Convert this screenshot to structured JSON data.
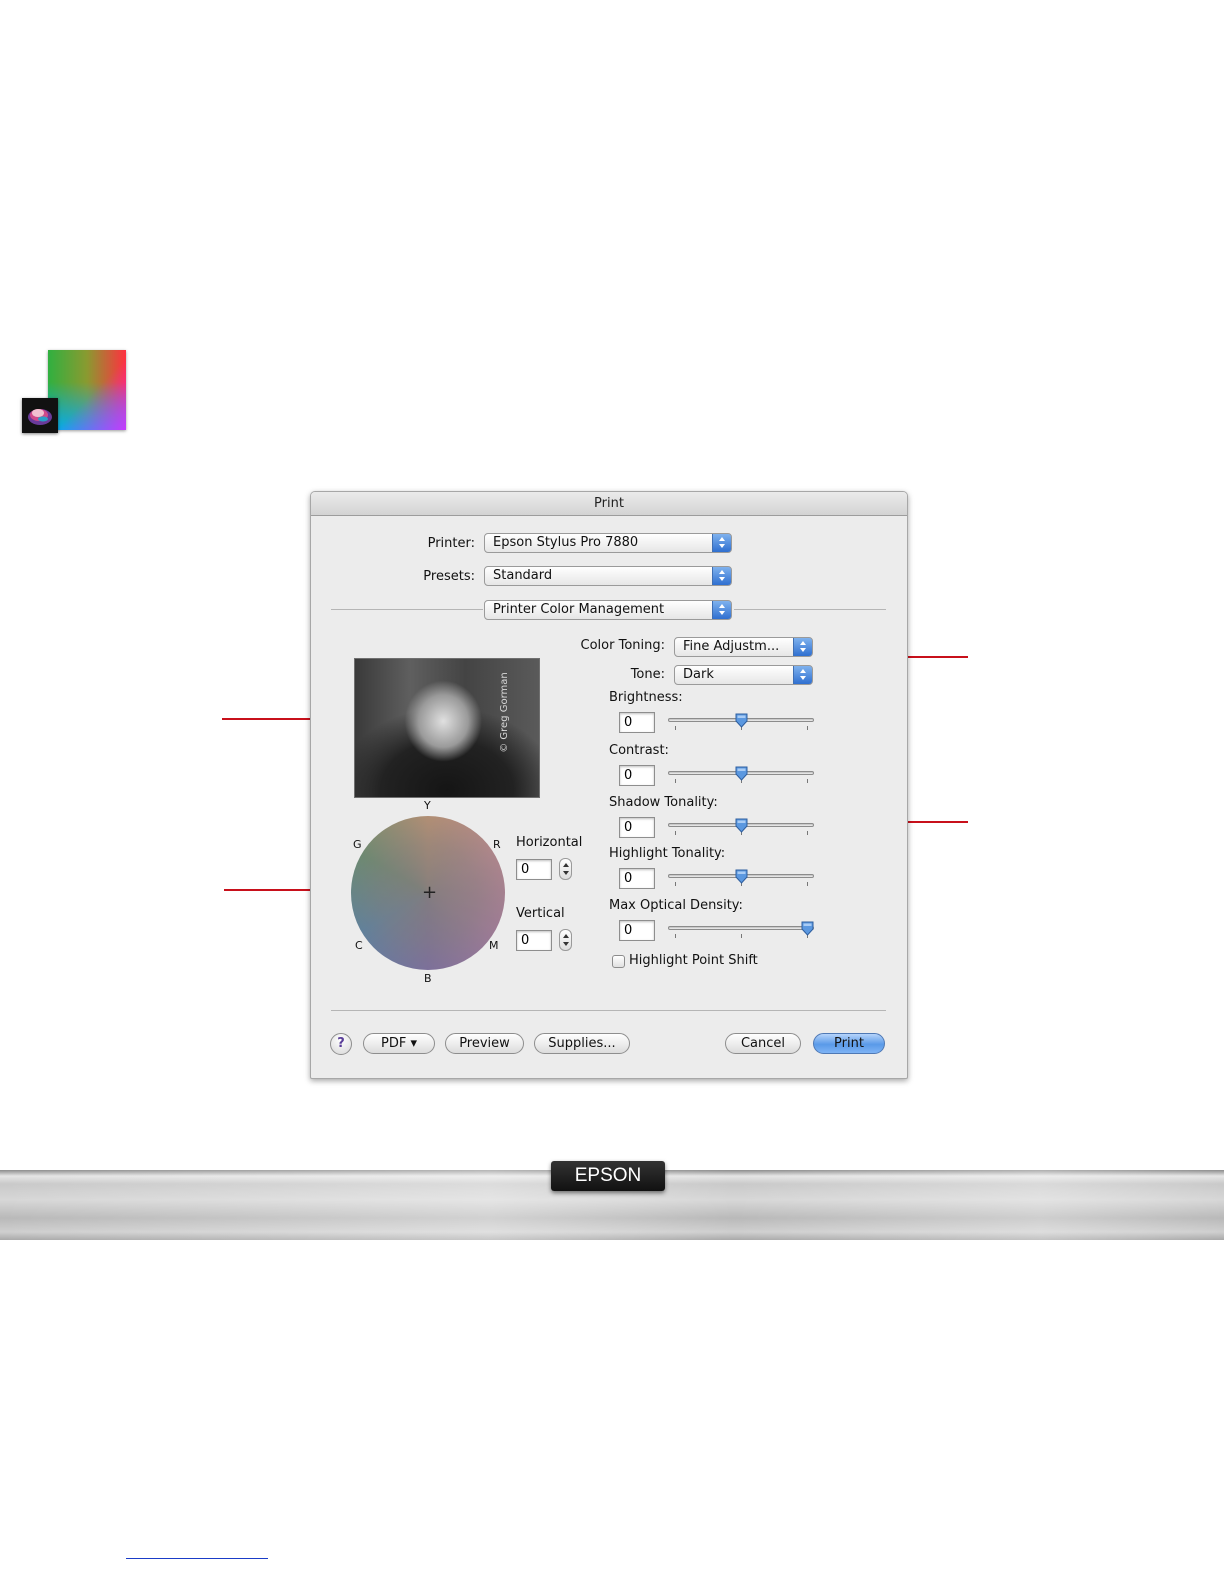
{
  "dialog": {
    "title": "Print",
    "printer": {
      "label": "Printer:",
      "value": "Epson Stylus Pro 7880"
    },
    "presets": {
      "label": "Presets:",
      "value": "Standard"
    },
    "panel": {
      "value": "Printer Color Management"
    },
    "color_toning": {
      "label": "Color Toning:",
      "value": "Fine Adjustm..."
    },
    "tone": {
      "label": "Tone:",
      "value": "Dark"
    },
    "sliders": [
      {
        "label": "Brightness:",
        "value": "0",
        "level": 0.5
      },
      {
        "label": "Contrast:",
        "value": "0",
        "level": 0.5
      },
      {
        "label": "Shadow Tonality:",
        "value": "0",
        "level": 0.5
      },
      {
        "label": "Highlight Tonality:",
        "value": "0",
        "level": 0.5
      },
      {
        "label": "Max Optical Density:",
        "value": "0",
        "level": 1.0
      }
    ],
    "highlight_point_shift": {
      "label": "Highlight Point Shift",
      "checked": false
    },
    "preview_photo": {
      "credit": "© Greg Gorman"
    },
    "color_wheel": {
      "labels": {
        "top": "Y",
        "top_left": "G",
        "top_right": "R",
        "bottom_left": "C",
        "bottom_right": "M",
        "bottom": "B"
      }
    },
    "horizontal": {
      "label": "Horizontal",
      "value": "0"
    },
    "vertical": {
      "label": "Vertical",
      "value": "0"
    },
    "buttons": {
      "help": "?",
      "pdf": "PDF ▾",
      "preview": "Preview",
      "supplies": "Supplies...",
      "cancel": "Cancel",
      "print": "Print"
    }
  },
  "branding": {
    "logo_text": "EPSON"
  },
  "colors": {
    "callout": "#c8101b",
    "accent": "#2f6fd0"
  }
}
